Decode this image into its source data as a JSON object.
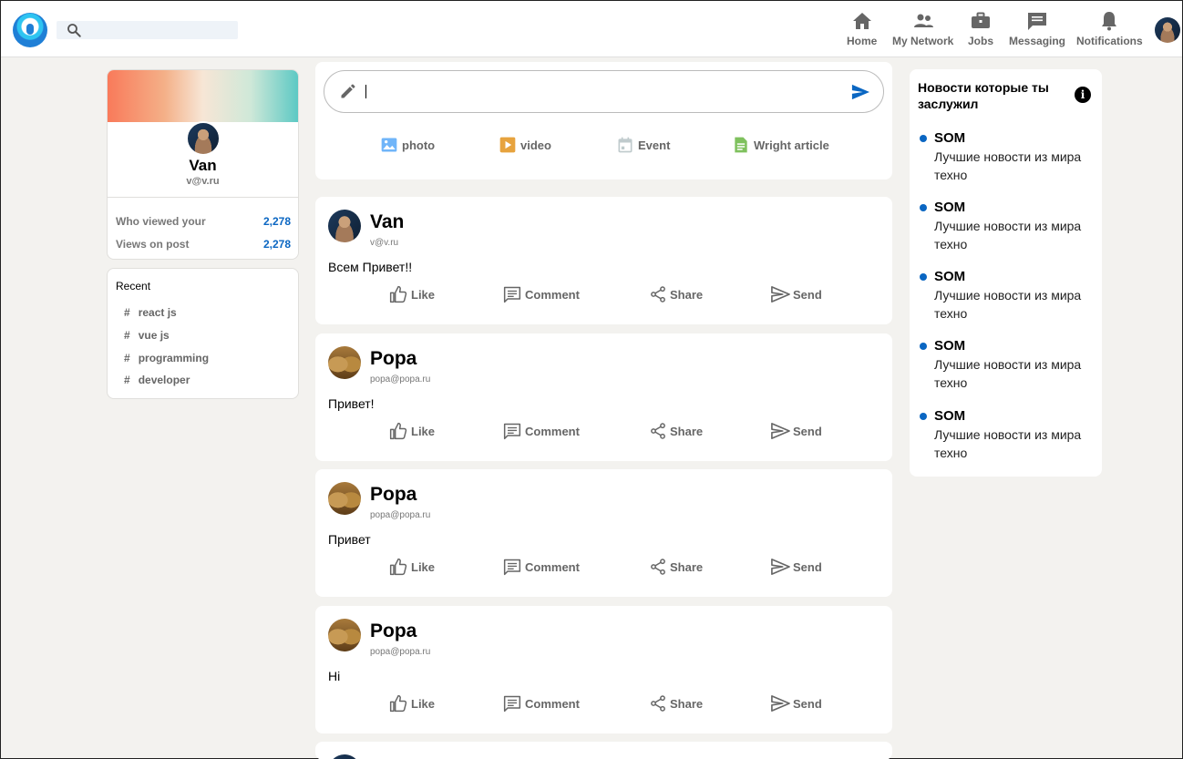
{
  "header": {
    "search_placeholder": "",
    "nav": {
      "home": "Home",
      "network": "My Network",
      "jobs": "Jobs",
      "messaging": "Messaging",
      "notifications": "Notifications"
    }
  },
  "profile": {
    "name": "Van",
    "email": "v@v.ru",
    "stats": [
      {
        "label": "Who viewed your",
        "value": "2,278"
      },
      {
        "label": "Views on post",
        "value": "2,278"
      }
    ]
  },
  "recent": {
    "title": "Recent",
    "hash": "#",
    "items": [
      "react js",
      "vue js",
      "programming",
      "developer"
    ]
  },
  "composer": {
    "value": "",
    "actions": {
      "photo": "photo",
      "video": "video",
      "event": "Event",
      "article": "Wright article"
    }
  },
  "post_actions": {
    "like": "Like",
    "comment": "Comment",
    "share": "Share",
    "send": "Send"
  },
  "posts": [
    {
      "name": "Van",
      "email": "v@v.ru",
      "text": "Всем Привет!!"
    },
    {
      "name": "Popa",
      "email": "popa@popa.ru",
      "text": "Привет!"
    },
    {
      "name": "Popa",
      "email": "popa@popa.ru",
      "text": "Привет"
    },
    {
      "name": "Popa",
      "email": "popa@popa.ru",
      "text": "Hi"
    }
  ],
  "news": {
    "title": "Новости которые ты заслужил",
    "info_glyph": "i",
    "items": [
      {
        "head": "SOM",
        "sub": "Лучшие новости из мира техно"
      },
      {
        "head": "SOM",
        "sub": "Лучшие новости из мира техно"
      },
      {
        "head": "SOM",
        "sub": "Лучшие новости из мира техно"
      },
      {
        "head": "SOM",
        "sub": "Лучшие новости из мира техно"
      },
      {
        "head": "SOM",
        "sub": "Лучшие новости из мира техно"
      }
    ]
  },
  "colors": {
    "accent": "#0a66c2",
    "background": "#f3f2ef",
    "icon_gray": "#666666",
    "photo_icon": "#70b5f9",
    "video_icon": "#e7a33e",
    "event_icon": "#c0cbcd",
    "article_icon": "#7fc15e"
  }
}
